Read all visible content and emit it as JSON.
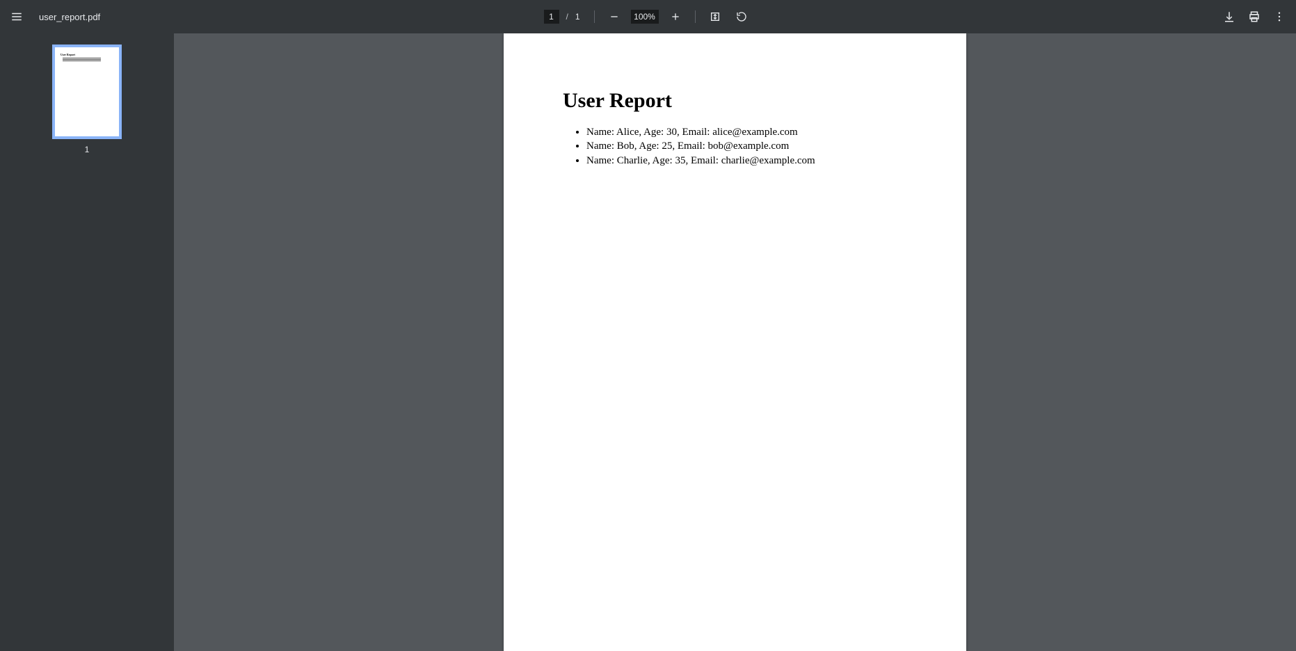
{
  "toolbar": {
    "filename": "user_report.pdf",
    "page_current": "1",
    "page_total": "1",
    "zoom": "100%"
  },
  "sidebar": {
    "thumbnails": [
      {
        "label": "1"
      }
    ]
  },
  "document": {
    "title": "User Report",
    "items": [
      "Name: Alice, Age: 30, Email: alice@example.com",
      "Name: Bob, Age: 25, Email: bob@example.com",
      "Name: Charlie, Age: 35, Email: charlie@example.com"
    ]
  }
}
